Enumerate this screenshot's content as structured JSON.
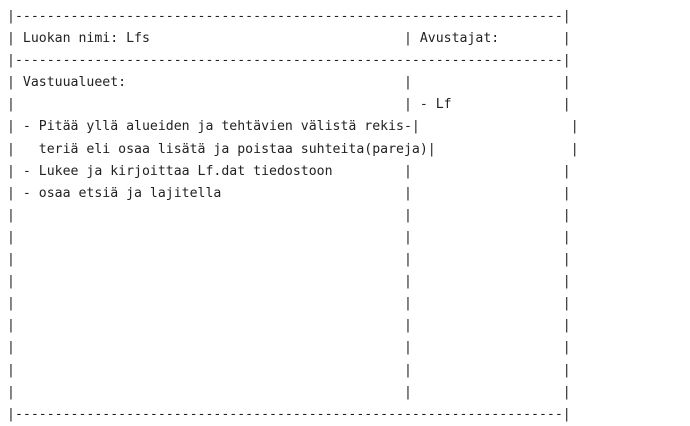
{
  "card": {
    "lines": [
      "|---------------------------------------------------------------------|",
      "| Luokan nimi: Lfs                                | Avustajat:        |",
      "|---------------------------------------------------------------------|",
      "| Vastuualueet:                                   |                   |",
      "|                                                 | - Lf              |",
      "| - Pitää yllä alueiden ja tehtävien välistä reki|                   |",
      "|   teriä eli osaa lisätä ja poistaa suhteita(pareja)|                |",
      "| - Lukee ja kirjoittaa Lf.dat tiedostoon         |                   |",
      "| - osaa etsiä ja lajitella                       |                   |",
      "|                                                 |                   |",
      "|                                                 |                   |",
      "|                                                 |                   |",
      "|                                                 |                   |",
      "|                                                 |                   |",
      "|                                                 |                   |",
      "|                                                 |                   |",
      "|                                                 |                   |",
      "|                                                 |                   |",
      "|---------------------------------------------------------------------|"
    ]
  }
}
